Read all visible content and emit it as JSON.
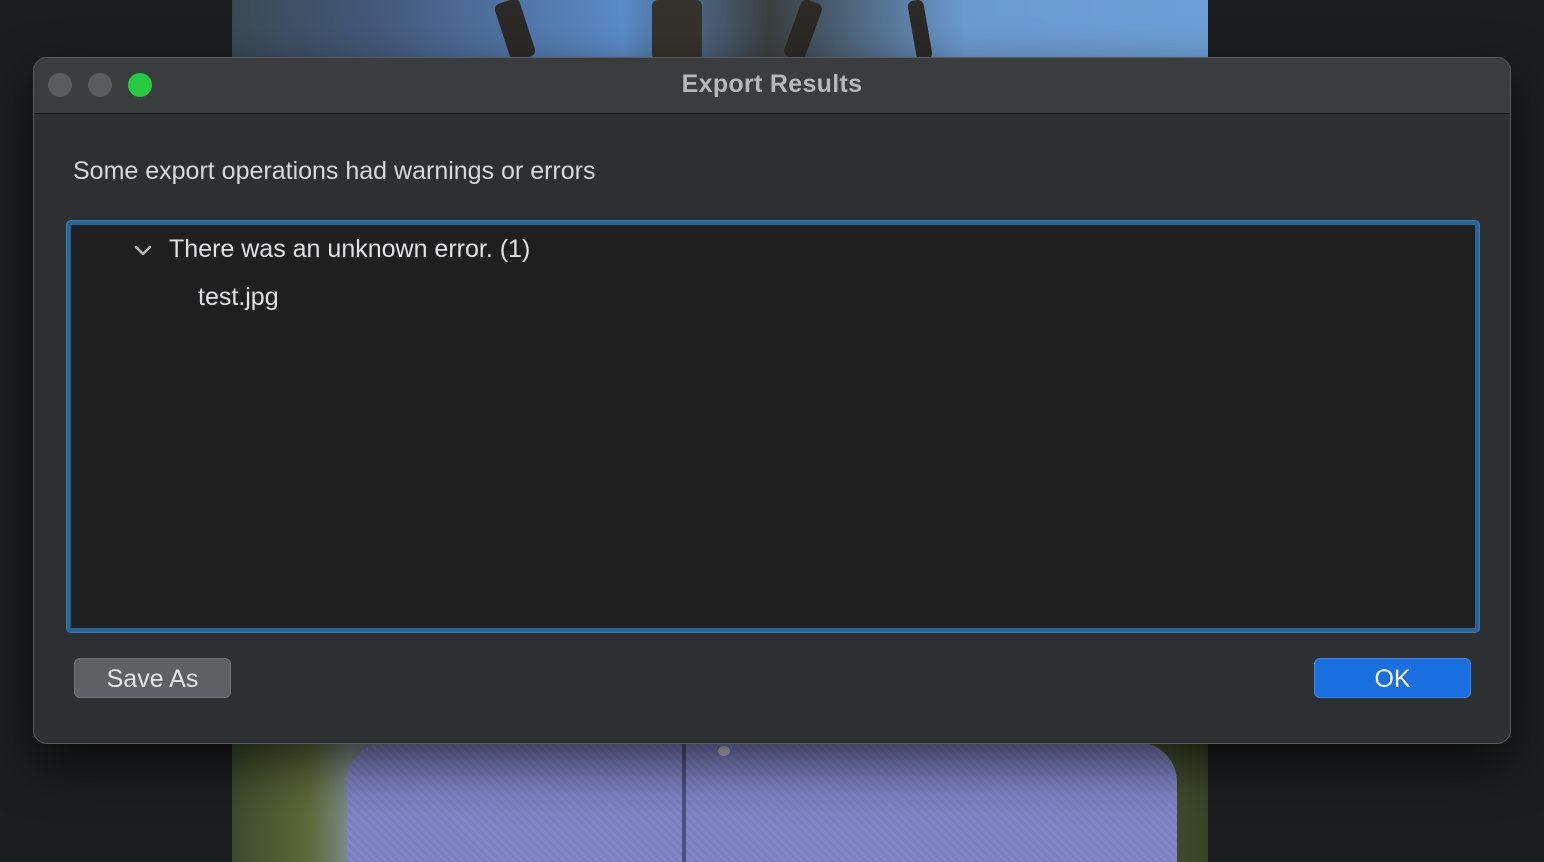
{
  "window": {
    "title": "Export Results",
    "traffic_lights": {
      "close_color": "#5b5c5e",
      "minimize_color": "#5b5c5e",
      "zoom_color": "#27c93f"
    }
  },
  "message": "Some export operations had warnings or errors",
  "results": {
    "groups": [
      {
        "label": "There was an unknown error. (1)",
        "expanded": true,
        "icon": "chevron-down-icon",
        "items": [
          "test.jpg"
        ]
      }
    ]
  },
  "buttons": {
    "save_as": "Save As",
    "ok": "OK"
  },
  "colors": {
    "accent": "#1a6fe0",
    "focus_ring": "#2a6396"
  }
}
